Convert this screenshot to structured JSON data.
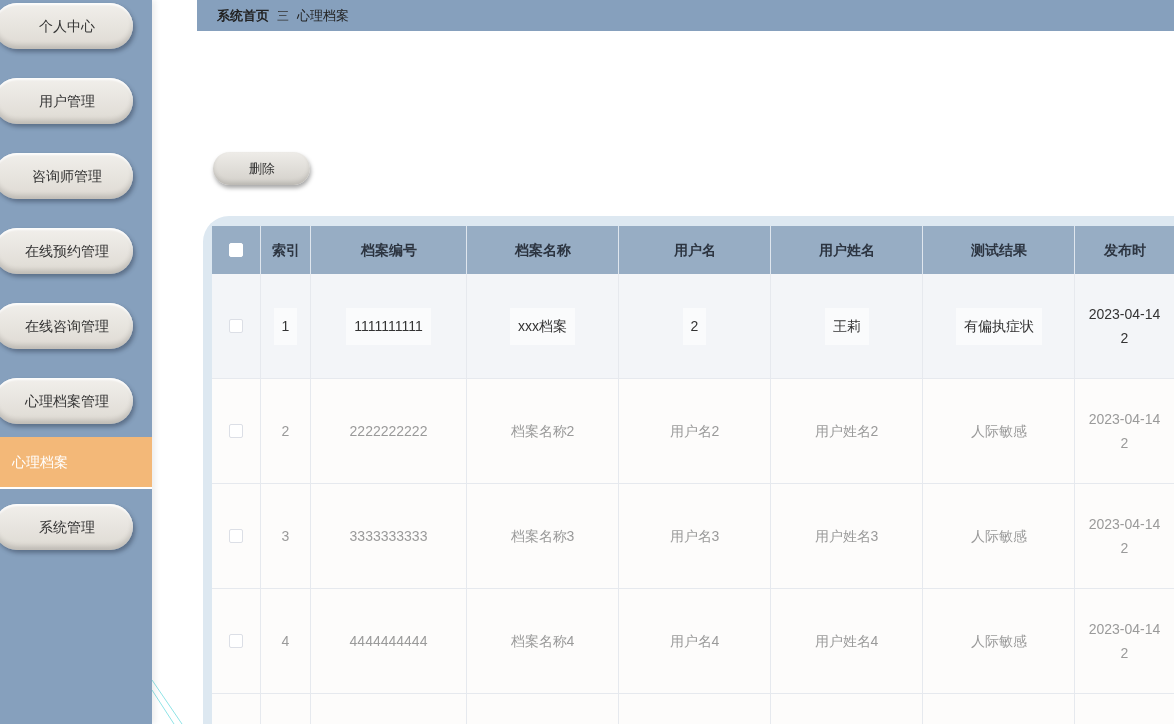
{
  "sidebar": {
    "items": [
      {
        "label": "个人中心",
        "kind": "menu",
        "selected": false
      },
      {
        "label": "用户管理",
        "kind": "menu",
        "selected": false
      },
      {
        "label": "咨询师管理",
        "kind": "menu",
        "selected": false
      },
      {
        "label": "在线预约管理",
        "kind": "menu",
        "selected": false
      },
      {
        "label": "在线咨询管理",
        "kind": "menu",
        "selected": false
      },
      {
        "label": "心理档案管理",
        "kind": "menu",
        "selected": false
      },
      {
        "label": "心理档案",
        "kind": "submenu",
        "selected": true
      },
      {
        "label": "系统管理",
        "kind": "menu",
        "selected": false
      }
    ]
  },
  "breadcrumb": {
    "home": "系统首页",
    "separator": "三",
    "current": "心理档案"
  },
  "toolbar": {
    "buttons": [
      "删除"
    ]
  },
  "table": {
    "header_checked": false,
    "columns": [
      "索引",
      "档案编号",
      "档案名称",
      "用户名",
      "用户姓名",
      "测试结果",
      "发布时"
    ],
    "rows": [
      {
        "highlighted": true,
        "checked": false,
        "cells": [
          "1",
          "1111111111",
          "xxx档案",
          "2",
          "王莉",
          "有偏执症状"
        ],
        "time": [
          "2023-04-14",
          "2"
        ]
      },
      {
        "highlighted": false,
        "checked": false,
        "cells": [
          "2",
          "2222222222",
          "档案名称2",
          "用户名2",
          "用户姓名2",
          "人际敏感"
        ],
        "time": [
          "2023-04-14",
          "2"
        ]
      },
      {
        "highlighted": false,
        "checked": false,
        "cells": [
          "3",
          "3333333333",
          "档案名称3",
          "用户名3",
          "用户姓名3",
          "人际敏感"
        ],
        "time": [
          "2023-04-14",
          "2"
        ]
      },
      {
        "highlighted": false,
        "checked": false,
        "cells": [
          "4",
          "4444444444",
          "档案名称4",
          "用户名4",
          "用户姓名4",
          "人际敏感"
        ],
        "time": [
          "2023-04-14",
          "2"
        ]
      }
    ]
  }
}
